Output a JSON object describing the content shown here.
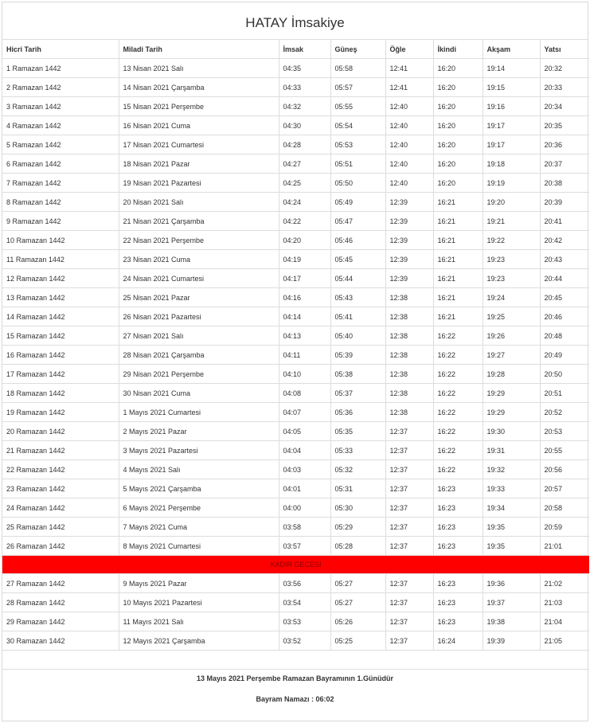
{
  "title": "HATAY İmsakiye",
  "columns": [
    "Hicri Tarih",
    "Miladi Tarih",
    "İmsak",
    "Güneş",
    "Öğle",
    "İkindi",
    "Akşam",
    "Yatsı"
  ],
  "rows_before": [
    [
      "1 Ramazan 1442",
      "13 Nisan 2021 Salı",
      "04:35",
      "05:58",
      "12:41",
      "16:20",
      "19:14",
      "20:32"
    ],
    [
      "2 Ramazan 1442",
      "14 Nisan 2021 Çarşamba",
      "04:33",
      "05:57",
      "12:41",
      "16:20",
      "19:15",
      "20:33"
    ],
    [
      "3 Ramazan 1442",
      "15 Nisan 2021 Perşembe",
      "04:32",
      "05:55",
      "12:40",
      "16:20",
      "19:16",
      "20:34"
    ],
    [
      "4 Ramazan 1442",
      "16 Nisan 2021 Cuma",
      "04:30",
      "05:54",
      "12:40",
      "16:20",
      "19:17",
      "20:35"
    ],
    [
      "5 Ramazan 1442",
      "17 Nisan 2021 Cumartesi",
      "04:28",
      "05:53",
      "12:40",
      "16:20",
      "19:17",
      "20:36"
    ],
    [
      "6 Ramazan 1442",
      "18 Nisan 2021 Pazar",
      "04:27",
      "05:51",
      "12:40",
      "16:20",
      "19:18",
      "20:37"
    ],
    [
      "7 Ramazan 1442",
      "19 Nisan 2021 Pazartesi",
      "04:25",
      "05:50",
      "12:40",
      "16:20",
      "19:19",
      "20:38"
    ],
    [
      "8 Ramazan 1442",
      "20 Nisan 2021 Salı",
      "04:24",
      "05:49",
      "12:39",
      "16:21",
      "19:20",
      "20:39"
    ],
    [
      "9 Ramazan 1442",
      "21 Nisan 2021 Çarşamba",
      "04:22",
      "05:47",
      "12:39",
      "16:21",
      "19:21",
      "20:41"
    ],
    [
      "10 Ramazan 1442",
      "22 Nisan 2021 Perşembe",
      "04:20",
      "05:46",
      "12:39",
      "16:21",
      "19:22",
      "20:42"
    ],
    [
      "11 Ramazan 1442",
      "23 Nisan 2021 Cuma",
      "04:19",
      "05:45",
      "12:39",
      "16:21",
      "19:23",
      "20:43"
    ],
    [
      "12 Ramazan 1442",
      "24 Nisan 2021 Cumartesi",
      "04:17",
      "05:44",
      "12:39",
      "16:21",
      "19:23",
      "20:44"
    ],
    [
      "13 Ramazan 1442",
      "25 Nisan 2021 Pazar",
      "04:16",
      "05:43",
      "12:38",
      "16:21",
      "19:24",
      "20:45"
    ],
    [
      "14 Ramazan 1442",
      "26 Nisan 2021 Pazartesi",
      "04:14",
      "05:41",
      "12:38",
      "16:21",
      "19:25",
      "20:46"
    ],
    [
      "15 Ramazan 1442",
      "27 Nisan 2021 Salı",
      "04:13",
      "05:40",
      "12:38",
      "16:22",
      "19:26",
      "20:48"
    ],
    [
      "16 Ramazan 1442",
      "28 Nisan 2021 Çarşamba",
      "04:11",
      "05:39",
      "12:38",
      "16:22",
      "19:27",
      "20:49"
    ],
    [
      "17 Ramazan 1442",
      "29 Nisan 2021 Perşembe",
      "04:10",
      "05:38",
      "12:38",
      "16:22",
      "19:28",
      "20:50"
    ],
    [
      "18 Ramazan 1442",
      "30 Nisan 2021 Cuma",
      "04:08",
      "05:37",
      "12:38",
      "16:22",
      "19:29",
      "20:51"
    ],
    [
      "19 Ramazan 1442",
      "1 Mayıs 2021 Cumartesi",
      "04:07",
      "05:36",
      "12:38",
      "16:22",
      "19:29",
      "20:52"
    ],
    [
      "20 Ramazan 1442",
      "2 Mayıs 2021 Pazar",
      "04:05",
      "05:35",
      "12:37",
      "16:22",
      "19:30",
      "20:53"
    ],
    [
      "21 Ramazan 1442",
      "3 Mayıs 2021 Pazartesi",
      "04:04",
      "05:33",
      "12:37",
      "16:22",
      "19:31",
      "20:55"
    ],
    [
      "22 Ramazan 1442",
      "4 Mayıs 2021 Salı",
      "04:03",
      "05:32",
      "12:37",
      "16:22",
      "19:32",
      "20:56"
    ],
    [
      "23 Ramazan 1442",
      "5 Mayıs 2021 Çarşamba",
      "04:01",
      "05:31",
      "12:37",
      "16:23",
      "19:33",
      "20:57"
    ],
    [
      "24 Ramazan 1442",
      "6 Mayıs 2021 Perşembe",
      "04:00",
      "05:30",
      "12:37",
      "16:23",
      "19:34",
      "20:58"
    ],
    [
      "25 Ramazan 1442",
      "7 Mayıs 2021 Cuma",
      "03:58",
      "05:29",
      "12:37",
      "16:23",
      "19:35",
      "20:59"
    ],
    [
      "26 Ramazan 1442",
      "8 Mayıs 2021 Cumartesi",
      "03:57",
      "05:28",
      "12:37",
      "16:23",
      "19:35",
      "21:01"
    ]
  ],
  "kadir_label": "KADIR GECESI",
  "rows_after": [
    [
      "27 Ramazan 1442",
      "9 Mayıs 2021 Pazar",
      "03:56",
      "05:27",
      "12:37",
      "16:23",
      "19:36",
      "21:02"
    ],
    [
      "28 Ramazan 1442",
      "10 Mayıs 2021 Pazartesi",
      "03:54",
      "05:27",
      "12:37",
      "16:23",
      "19:37",
      "21:03"
    ],
    [
      "29 Ramazan 1442",
      "11 Mayıs 2021 Salı",
      "03:53",
      "05:26",
      "12:37",
      "16:23",
      "19:38",
      "21:04"
    ],
    [
      "30 Ramazan 1442",
      "12 Mayıs 2021 Çarşamba",
      "03:52",
      "05:25",
      "12:37",
      "16:24",
      "19:39",
      "21:05"
    ]
  ],
  "footer": {
    "bayram_text": "13 Mayıs 2021 Perşembe Ramazan Bayramının 1.Günüdür",
    "namaz_text": "Bayram Namazı : 06:02"
  },
  "colors": {
    "kadir_bg": "#ff0000",
    "kadir_text": "#8b0000",
    "border": "#dddddd"
  }
}
